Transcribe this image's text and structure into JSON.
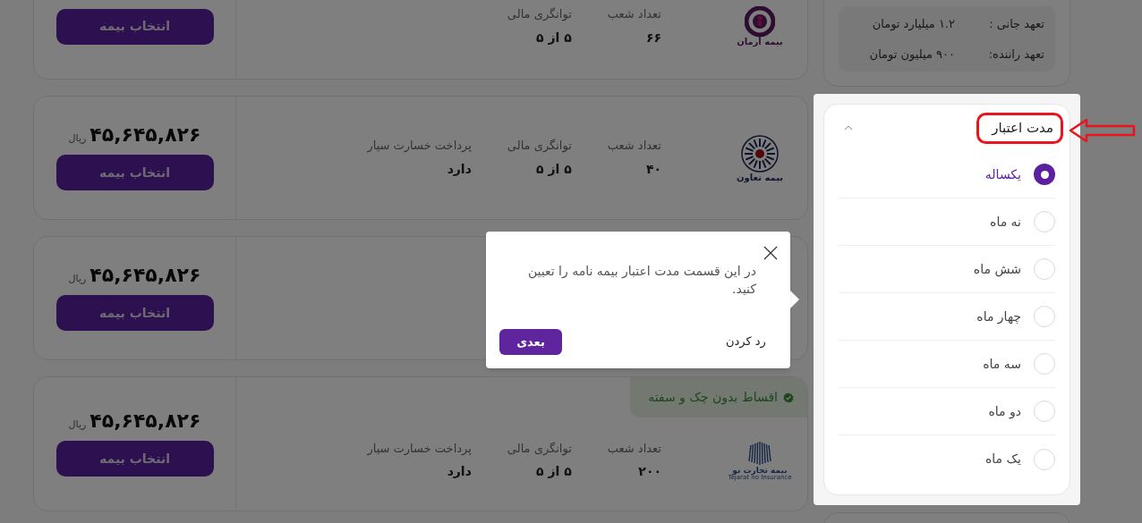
{
  "quotes": [
    {
      "logo": {
        "kind": "arman",
        "text": "بیمه آرمان"
      },
      "details": [
        {
          "label": "تعداد شعب",
          "value": "۶۶"
        },
        {
          "label": "توانگری مالی",
          "value": "۵ از ۵"
        }
      ],
      "button": "انتخاب بیمه"
    },
    {
      "logo": {
        "kind": "taavon",
        "text": "بیمه تعاون"
      },
      "price": "۴۵,۶۴۵,۸۲۶",
      "currency": "ریال",
      "details": [
        {
          "label": "تعداد شعب",
          "value": "۴۰"
        },
        {
          "label": "توانگری مالی",
          "value": "۵ از ۵"
        },
        {
          "label": "پرداخت خسارت سیار",
          "value": "دارد"
        }
      ],
      "button": "انتخاب بیمه"
    },
    {
      "price": "۴۵,۶۴۵,۸۲۶",
      "currency": "ریال",
      "button": "انتخاب بیمه"
    },
    {
      "badge": "اقساط بدون چک و سفته",
      "logo": {
        "kind": "tejarat",
        "text": "بیمه تجارت نو",
        "subtext": "Tejarat no Insurance"
      },
      "price": "۴۵,۶۴۵,۸۲۶",
      "currency": "ریال",
      "details": [
        {
          "label": "تعداد شعب",
          "value": "۲۰۰"
        },
        {
          "label": "توانگری مالی",
          "value": "۵ از ۵"
        },
        {
          "label": "پرداخت خسارت سیار",
          "value": "دارد"
        }
      ],
      "button": "انتخاب بیمه"
    }
  ],
  "coverage": [
    {
      "label": "تعهد جانی :",
      "value": "۱.۲ میلیارد تومان"
    },
    {
      "label": "تعهد راننده:",
      "value": "۹۰۰ میلیون تومان"
    }
  ],
  "period_filter": {
    "title": "مدت اعتبار",
    "expanded": true,
    "options": [
      {
        "label": "یکساله",
        "selected": true
      },
      {
        "label": "نه ماه",
        "selected": false
      },
      {
        "label": "شش ماه",
        "selected": false
      },
      {
        "label": "چهار ماه",
        "selected": false
      },
      {
        "label": "سه ماه",
        "selected": false
      },
      {
        "label": "دو ماه",
        "selected": false
      },
      {
        "label": "یک ماه",
        "selected": false
      }
    ]
  },
  "tour_popup": {
    "text": "در این قسمت مدت اعتبار بیمه نامه را تعیین کنید.",
    "dismiss": "رد کردن",
    "next": "بعدی"
  }
}
